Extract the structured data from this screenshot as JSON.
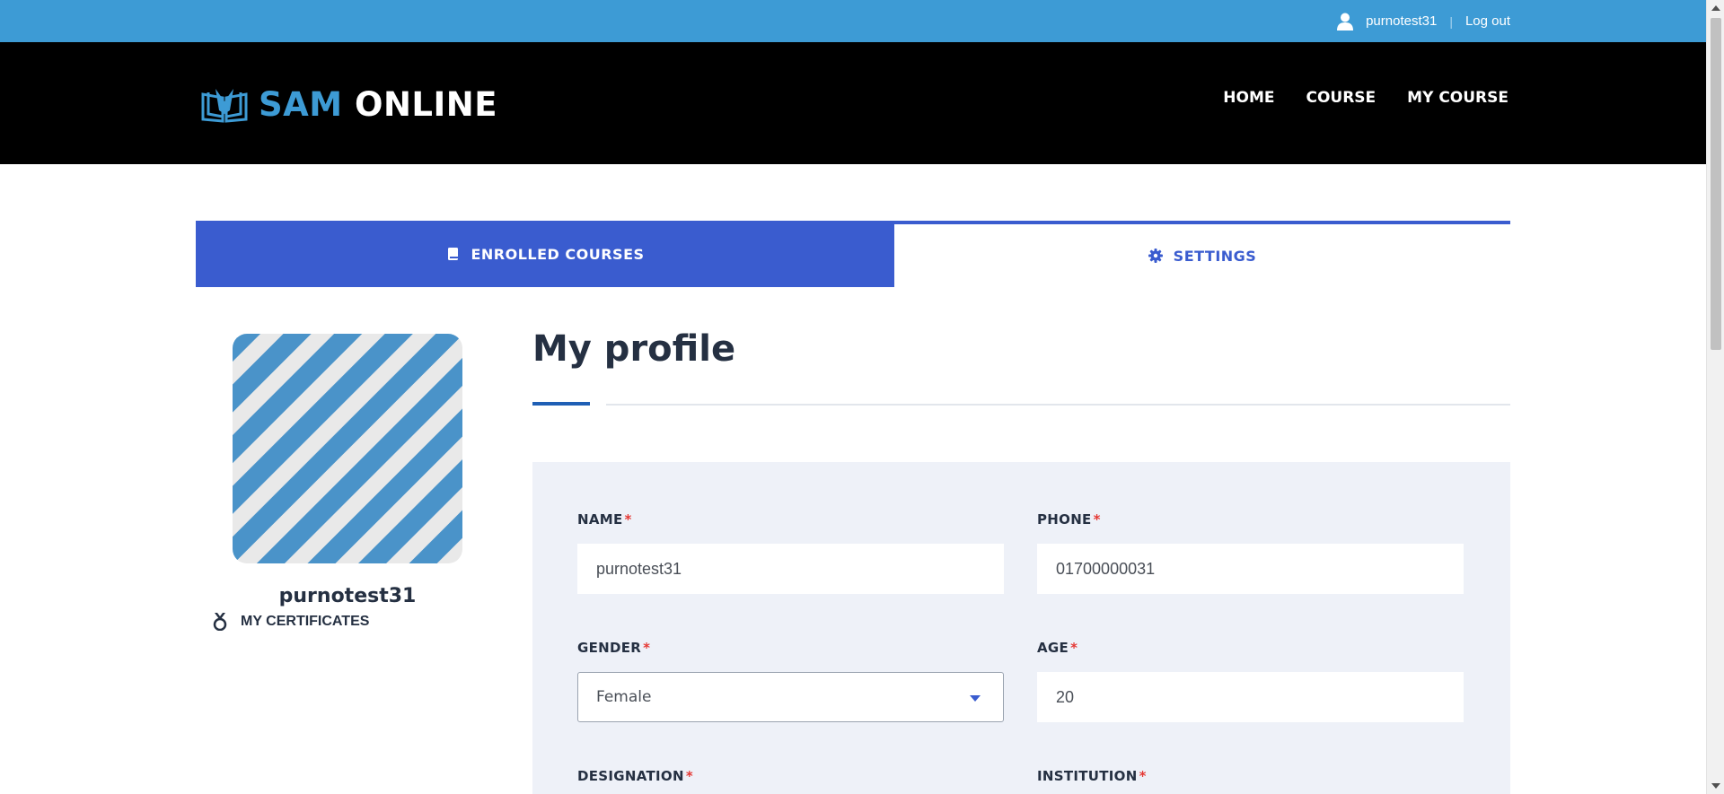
{
  "topbar": {
    "username": "purnotest31",
    "logout_label": "Log out",
    "separator": "|",
    "user_icon": "user-icon"
  },
  "header": {
    "logo": {
      "part1": "SAM",
      "part2": "ONLINE",
      "icon": "open-book-icon"
    },
    "nav": [
      "HOME",
      "COURSE",
      "MY COURSE"
    ]
  },
  "tabs": [
    {
      "label": "ENROLLED COURSES",
      "icon": "book-icon",
      "active": true
    },
    {
      "label": "SETTINGS",
      "icon": "gear-icon",
      "active": false
    }
  ],
  "sidebar": {
    "username": "purnotest31",
    "certificates_label": "MY CERTIFICATES",
    "certificates_icon": "medal-icon"
  },
  "profile": {
    "title": "My profile",
    "fields": {
      "name": {
        "label": "NAME",
        "value": "purnotest31",
        "required_mark": "*"
      },
      "phone": {
        "label": "PHONE",
        "value": "01700000031",
        "required_mark": "*"
      },
      "gender": {
        "label": "GENDER",
        "value": "Female",
        "required_mark": "*"
      },
      "age": {
        "label": "AGE",
        "value": "20",
        "required_mark": "*"
      },
      "designation": {
        "label": "DESIGNATION",
        "required_mark": "*"
      },
      "institution": {
        "label": "INSTITUTION",
        "required_mark": "*"
      }
    }
  },
  "colors": {
    "topbar": "#3d9bd5",
    "header": "#000000",
    "accent_blue": "#3a5ccf",
    "logo_blue": "#3d9bd5",
    "panel_bg": "#eef1f8",
    "required_red": "#e53935",
    "text_dark": "#253042"
  }
}
